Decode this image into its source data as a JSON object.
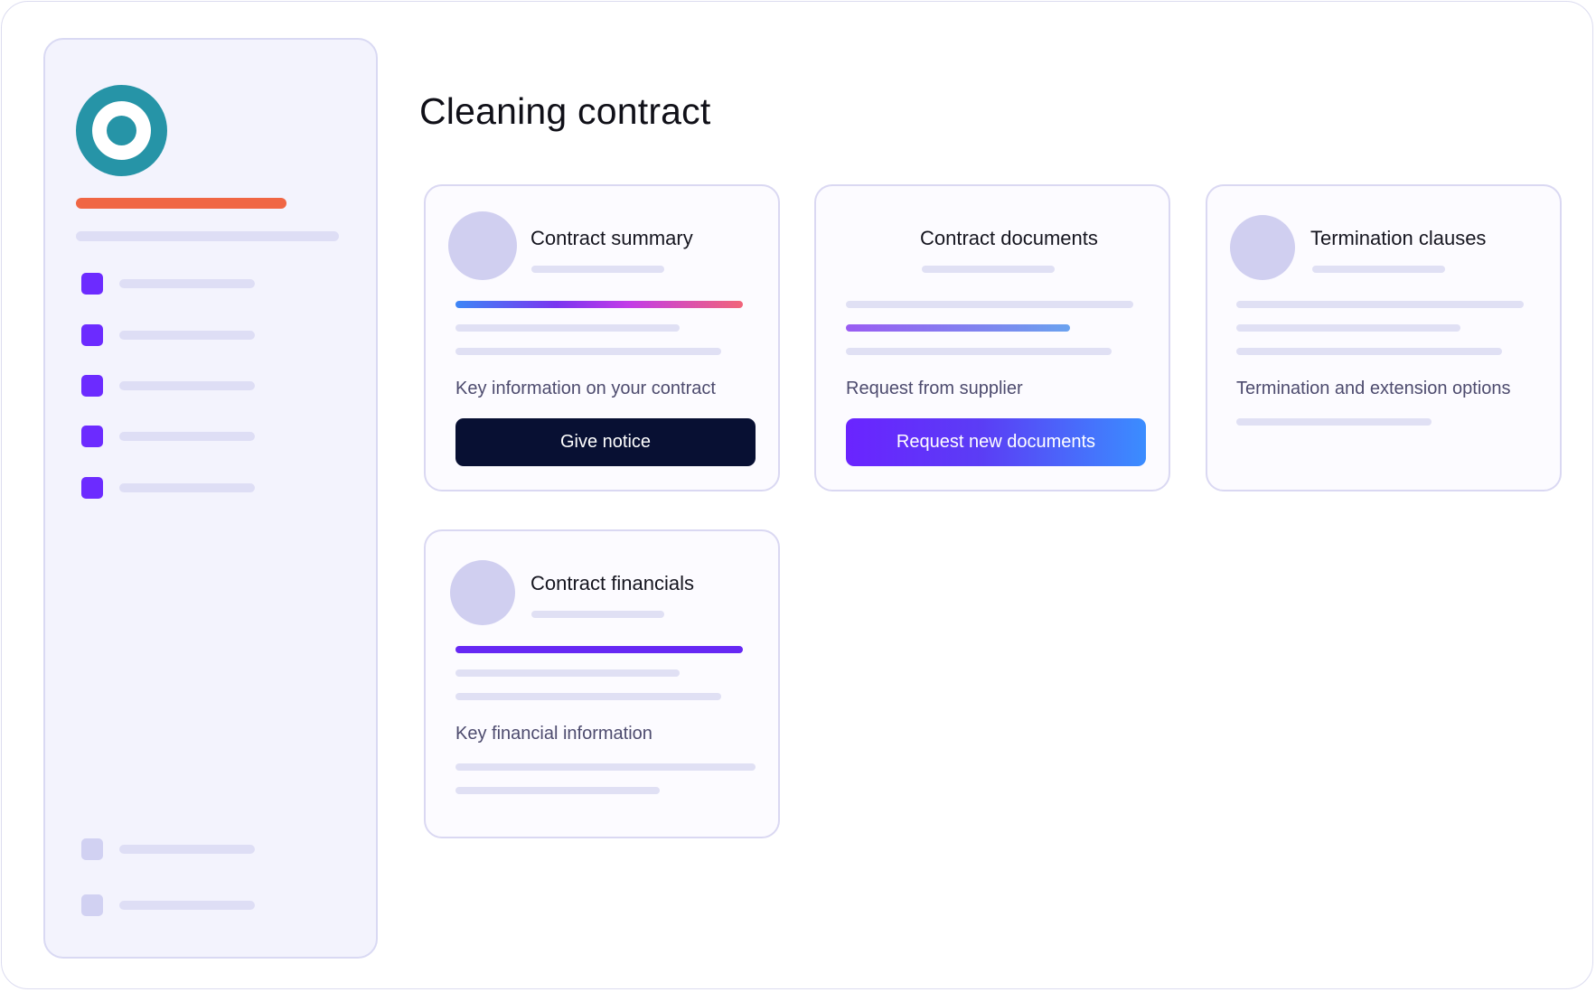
{
  "page": {
    "title": "Cleaning contract"
  },
  "colors": {
    "logo_teal": "#2694a7",
    "brand_orange": "#f06644",
    "nav_purple": "#6c2bff",
    "dark_button": "#081033",
    "gradient_start": "#6a24ff",
    "gradient_end": "#3b8dff"
  },
  "sidebar": {
    "logo_icon": "ring-logo-icon",
    "items": [
      {
        "icon": "square-icon"
      },
      {
        "icon": "square-icon"
      },
      {
        "icon": "square-icon"
      },
      {
        "icon": "square-icon"
      },
      {
        "icon": "square-icon"
      }
    ],
    "footer_items": [
      {
        "icon": "square-icon"
      },
      {
        "icon": "square-icon"
      }
    ]
  },
  "cards": {
    "summary": {
      "title": "Contract summary",
      "description": "Key information on your contract",
      "button_label": "Give notice"
    },
    "documents": {
      "title": "Contract documents",
      "description": "Request from supplier",
      "button_label": "Request new documents"
    },
    "termination": {
      "title": "Termination clauses",
      "description": "Termination and extension options"
    },
    "financials": {
      "title": "Contract financials",
      "description": "Key financial information"
    }
  }
}
